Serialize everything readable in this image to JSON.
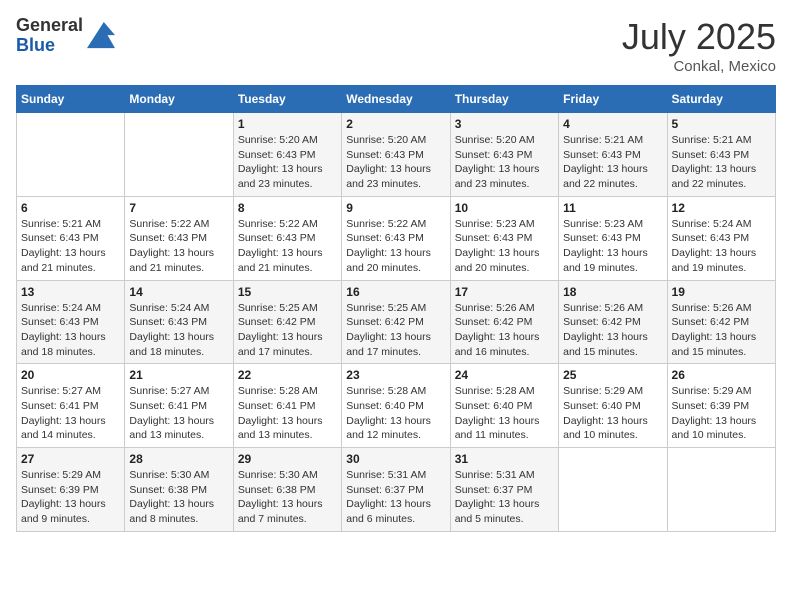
{
  "logo": {
    "general": "General",
    "blue": "Blue"
  },
  "title": "July 2025",
  "subtitle": "Conkal, Mexico",
  "days_header": [
    "Sunday",
    "Monday",
    "Tuesday",
    "Wednesday",
    "Thursday",
    "Friday",
    "Saturday"
  ],
  "weeks": [
    [
      {
        "day": "",
        "sunrise": "",
        "sunset": "",
        "daylight": ""
      },
      {
        "day": "",
        "sunrise": "",
        "sunset": "",
        "daylight": ""
      },
      {
        "day": "1",
        "sunrise": "Sunrise: 5:20 AM",
        "sunset": "Sunset: 6:43 PM",
        "daylight": "Daylight: 13 hours and 23 minutes."
      },
      {
        "day": "2",
        "sunrise": "Sunrise: 5:20 AM",
        "sunset": "Sunset: 6:43 PM",
        "daylight": "Daylight: 13 hours and 23 minutes."
      },
      {
        "day": "3",
        "sunrise": "Sunrise: 5:20 AM",
        "sunset": "Sunset: 6:43 PM",
        "daylight": "Daylight: 13 hours and 23 minutes."
      },
      {
        "day": "4",
        "sunrise": "Sunrise: 5:21 AM",
        "sunset": "Sunset: 6:43 PM",
        "daylight": "Daylight: 13 hours and 22 minutes."
      },
      {
        "day": "5",
        "sunrise": "Sunrise: 5:21 AM",
        "sunset": "Sunset: 6:43 PM",
        "daylight": "Daylight: 13 hours and 22 minutes."
      }
    ],
    [
      {
        "day": "6",
        "sunrise": "Sunrise: 5:21 AM",
        "sunset": "Sunset: 6:43 PM",
        "daylight": "Daylight: 13 hours and 21 minutes."
      },
      {
        "day": "7",
        "sunrise": "Sunrise: 5:22 AM",
        "sunset": "Sunset: 6:43 PM",
        "daylight": "Daylight: 13 hours and 21 minutes."
      },
      {
        "day": "8",
        "sunrise": "Sunrise: 5:22 AM",
        "sunset": "Sunset: 6:43 PM",
        "daylight": "Daylight: 13 hours and 21 minutes."
      },
      {
        "day": "9",
        "sunrise": "Sunrise: 5:22 AM",
        "sunset": "Sunset: 6:43 PM",
        "daylight": "Daylight: 13 hours and 20 minutes."
      },
      {
        "day": "10",
        "sunrise": "Sunrise: 5:23 AM",
        "sunset": "Sunset: 6:43 PM",
        "daylight": "Daylight: 13 hours and 20 minutes."
      },
      {
        "day": "11",
        "sunrise": "Sunrise: 5:23 AM",
        "sunset": "Sunset: 6:43 PM",
        "daylight": "Daylight: 13 hours and 19 minutes."
      },
      {
        "day": "12",
        "sunrise": "Sunrise: 5:24 AM",
        "sunset": "Sunset: 6:43 PM",
        "daylight": "Daylight: 13 hours and 19 minutes."
      }
    ],
    [
      {
        "day": "13",
        "sunrise": "Sunrise: 5:24 AM",
        "sunset": "Sunset: 6:43 PM",
        "daylight": "Daylight: 13 hours and 18 minutes."
      },
      {
        "day": "14",
        "sunrise": "Sunrise: 5:24 AM",
        "sunset": "Sunset: 6:43 PM",
        "daylight": "Daylight: 13 hours and 18 minutes."
      },
      {
        "day": "15",
        "sunrise": "Sunrise: 5:25 AM",
        "sunset": "Sunset: 6:42 PM",
        "daylight": "Daylight: 13 hours and 17 minutes."
      },
      {
        "day": "16",
        "sunrise": "Sunrise: 5:25 AM",
        "sunset": "Sunset: 6:42 PM",
        "daylight": "Daylight: 13 hours and 17 minutes."
      },
      {
        "day": "17",
        "sunrise": "Sunrise: 5:26 AM",
        "sunset": "Sunset: 6:42 PM",
        "daylight": "Daylight: 13 hours and 16 minutes."
      },
      {
        "day": "18",
        "sunrise": "Sunrise: 5:26 AM",
        "sunset": "Sunset: 6:42 PM",
        "daylight": "Daylight: 13 hours and 15 minutes."
      },
      {
        "day": "19",
        "sunrise": "Sunrise: 5:26 AM",
        "sunset": "Sunset: 6:42 PM",
        "daylight": "Daylight: 13 hours and 15 minutes."
      }
    ],
    [
      {
        "day": "20",
        "sunrise": "Sunrise: 5:27 AM",
        "sunset": "Sunset: 6:41 PM",
        "daylight": "Daylight: 13 hours and 14 minutes."
      },
      {
        "day": "21",
        "sunrise": "Sunrise: 5:27 AM",
        "sunset": "Sunset: 6:41 PM",
        "daylight": "Daylight: 13 hours and 13 minutes."
      },
      {
        "day": "22",
        "sunrise": "Sunrise: 5:28 AM",
        "sunset": "Sunset: 6:41 PM",
        "daylight": "Daylight: 13 hours and 13 minutes."
      },
      {
        "day": "23",
        "sunrise": "Sunrise: 5:28 AM",
        "sunset": "Sunset: 6:40 PM",
        "daylight": "Daylight: 13 hours and 12 minutes."
      },
      {
        "day": "24",
        "sunrise": "Sunrise: 5:28 AM",
        "sunset": "Sunset: 6:40 PM",
        "daylight": "Daylight: 13 hours and 11 minutes."
      },
      {
        "day": "25",
        "sunrise": "Sunrise: 5:29 AM",
        "sunset": "Sunset: 6:40 PM",
        "daylight": "Daylight: 13 hours and 10 minutes."
      },
      {
        "day": "26",
        "sunrise": "Sunrise: 5:29 AM",
        "sunset": "Sunset: 6:39 PM",
        "daylight": "Daylight: 13 hours and 10 minutes."
      }
    ],
    [
      {
        "day": "27",
        "sunrise": "Sunrise: 5:29 AM",
        "sunset": "Sunset: 6:39 PM",
        "daylight": "Daylight: 13 hours and 9 minutes."
      },
      {
        "day": "28",
        "sunrise": "Sunrise: 5:30 AM",
        "sunset": "Sunset: 6:38 PM",
        "daylight": "Daylight: 13 hours and 8 minutes."
      },
      {
        "day": "29",
        "sunrise": "Sunrise: 5:30 AM",
        "sunset": "Sunset: 6:38 PM",
        "daylight": "Daylight: 13 hours and 7 minutes."
      },
      {
        "day": "30",
        "sunrise": "Sunrise: 5:31 AM",
        "sunset": "Sunset: 6:37 PM",
        "daylight": "Daylight: 13 hours and 6 minutes."
      },
      {
        "day": "31",
        "sunrise": "Sunrise: 5:31 AM",
        "sunset": "Sunset: 6:37 PM",
        "daylight": "Daylight: 13 hours and 5 minutes."
      },
      {
        "day": "",
        "sunrise": "",
        "sunset": "",
        "daylight": ""
      },
      {
        "day": "",
        "sunrise": "",
        "sunset": "",
        "daylight": ""
      }
    ]
  ]
}
